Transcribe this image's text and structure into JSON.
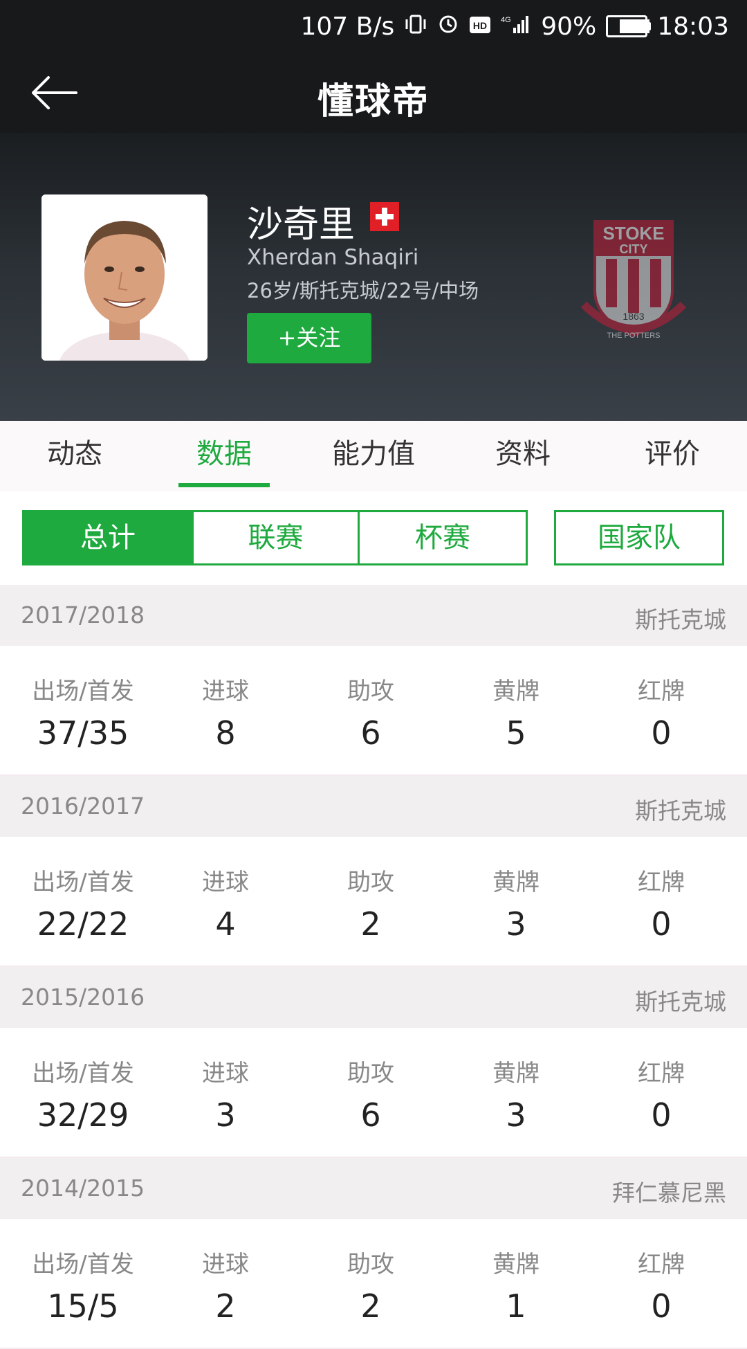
{
  "status_bar": {
    "net_speed": "107 B/s",
    "battery": "90%",
    "battery_level": 0.9,
    "time": "18:03",
    "icons": [
      "vibrate-icon",
      "alarm-icon",
      "hd-icon",
      "signal-4g-icon",
      "battery-icon"
    ]
  },
  "app_bar": {
    "title": "懂球帝",
    "back_icon": "arrow-left-icon"
  },
  "player": {
    "name": "沙奇里",
    "english_name": "Xherdan Shaqiri",
    "info": "26岁/斯托克城/22号/中场",
    "follow_label": "+关注",
    "flag": "switzerland-flag"
  },
  "tabs": [
    {
      "label": "动态"
    },
    {
      "label": "数据",
      "active": true
    },
    {
      "label": "能力值"
    },
    {
      "label": "资料"
    },
    {
      "label": "评价"
    }
  ],
  "filters": {
    "segments": [
      "总计",
      "联赛",
      "杯赛"
    ],
    "national": "国家队",
    "selected": "总计"
  },
  "colors": {
    "accent": "#1eaa3e",
    "header_bg": "#17191a"
  },
  "stat_labels": [
    "出场/首发",
    "进球",
    "助攻",
    "黄牌",
    "红牌"
  ],
  "seasons": [
    {
      "season": "2017/2018",
      "team": "斯托克城",
      "values": [
        "37/35",
        "8",
        "6",
        "5",
        "0"
      ]
    },
    {
      "season": "2016/2017",
      "team": "斯托克城",
      "values": [
        "22/22",
        "4",
        "2",
        "3",
        "0"
      ]
    },
    {
      "season": "2015/2016",
      "team": "斯托克城",
      "values": [
        "32/29",
        "3",
        "6",
        "3",
        "0"
      ]
    },
    {
      "season": "2014/2015",
      "team": "拜仁慕尼黑",
      "values": [
        "15/5",
        "2",
        "2",
        "1",
        "0"
      ]
    }
  ]
}
